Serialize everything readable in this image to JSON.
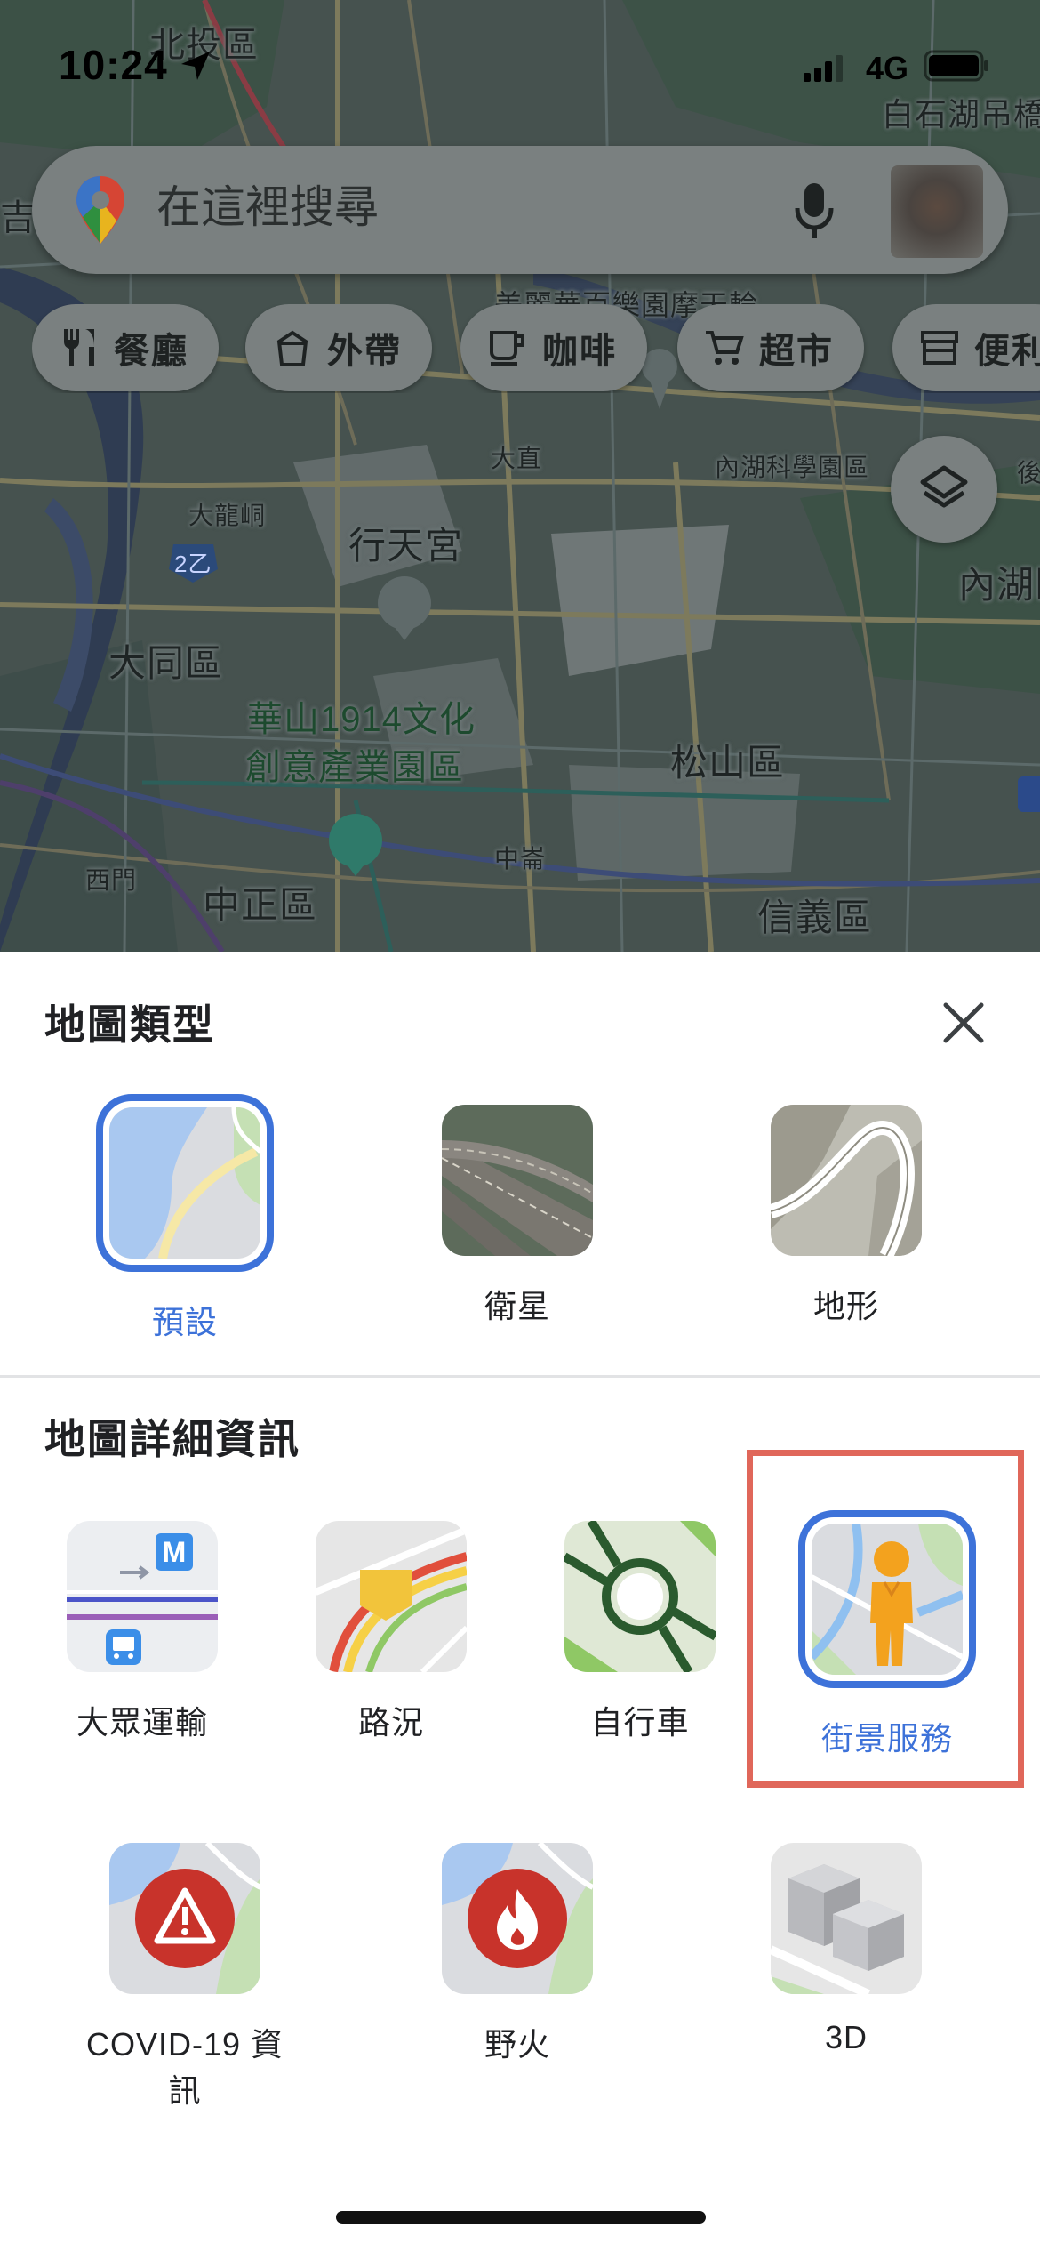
{
  "status_bar": {
    "time": "10:24",
    "network": "4G"
  },
  "map": {
    "labels": {
      "beitou": "北投區",
      "baishi": "白石湖吊橋",
      "ji": "吉",
      "meiliHua": "美麗華百樂園摩天輪",
      "dazhi": "大直",
      "neihuScience": "內湖科學園區",
      "hou": "後",
      "dalongdong": "大龍峒",
      "route": "2乙",
      "xingtian": "行天宮",
      "neihu": "內湖區",
      "datong": "大同區",
      "huashan1": "華山1914文化",
      "huashan2": "創意產業園區",
      "songshan": "松山區",
      "ximen": "西門",
      "zhongpu": "中崙",
      "zhongzheng": "中正區",
      "xinyi": "信義區",
      "metroBadge": "M"
    }
  },
  "search": {
    "placeholder": "在這裡搜尋"
  },
  "chips": [
    {
      "label": "餐廳",
      "icon": "restaurant-icon"
    },
    {
      "label": "外帶",
      "icon": "takeout-icon"
    },
    {
      "label": "咖啡",
      "icon": "coffee-icon"
    },
    {
      "label": "超市",
      "icon": "cart-icon"
    },
    {
      "label": "便利",
      "icon": "store-icon"
    }
  ],
  "sheet": {
    "map_type_title": "地圖類型",
    "map_types": [
      {
        "label": "預設",
        "selected": true
      },
      {
        "label": "衛星",
        "selected": false
      },
      {
        "label": "地形",
        "selected": false
      }
    ],
    "details_title": "地圖詳細資訊",
    "details": [
      {
        "label": "大眾運輸",
        "selected": false,
        "badge": "M"
      },
      {
        "label": "路況",
        "selected": false
      },
      {
        "label": "自行車",
        "selected": false
      },
      {
        "label": "街景服務",
        "selected": true
      },
      {
        "label": "COVID-19 資訊",
        "selected": false
      },
      {
        "label": "野火",
        "selected": false
      },
      {
        "label": "3D",
        "selected": false
      }
    ]
  },
  "colors": {
    "accent": "#3d72d9",
    "highlight": "#e0675a"
  }
}
